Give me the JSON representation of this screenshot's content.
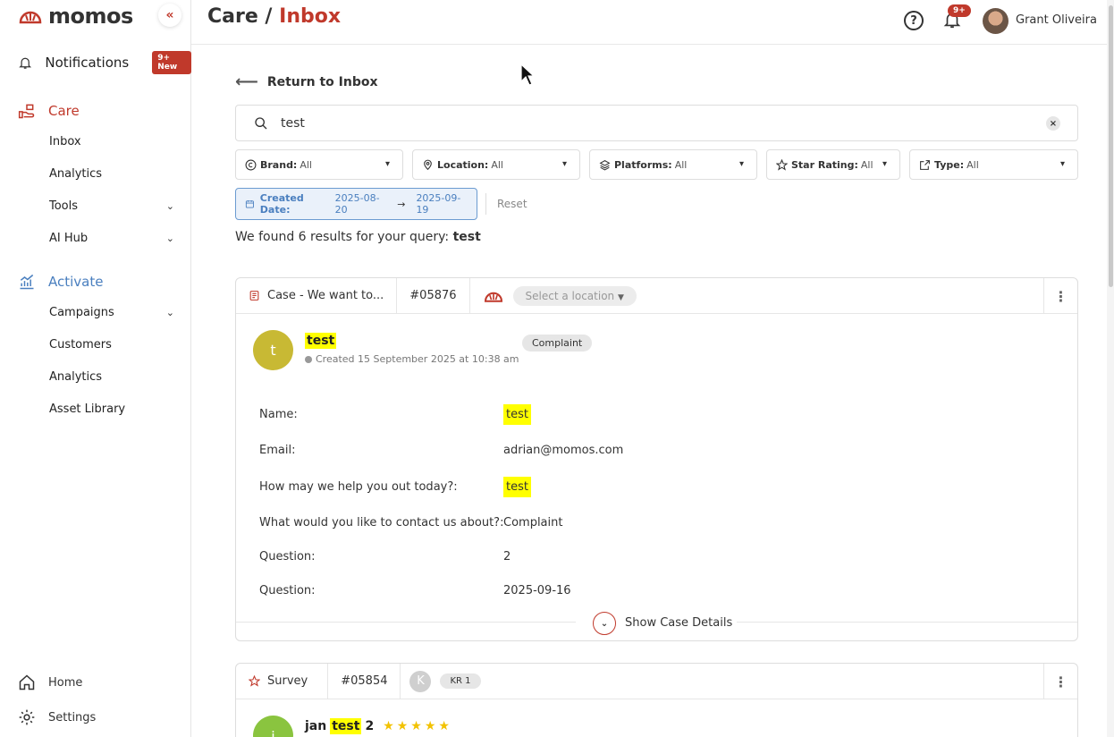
{
  "brand": {
    "name": "momos",
    "collapse": "«"
  },
  "sidebar": {
    "notifications": {
      "label": "Notifications",
      "badge": "9+ New"
    },
    "care": {
      "label": "Care",
      "items": [
        {
          "label": "Inbox"
        },
        {
          "label": "Analytics"
        },
        {
          "label": "Tools",
          "expandable": true
        },
        {
          "label": "AI Hub",
          "expandable": true
        }
      ]
    },
    "activate": {
      "label": "Activate",
      "items": [
        {
          "label": "Campaigns",
          "expandable": true
        },
        {
          "label": "Customers"
        },
        {
          "label": "Analytics"
        },
        {
          "label": "Asset Library"
        }
      ]
    },
    "home": "Home",
    "settings": "Settings"
  },
  "header": {
    "crumb_parent": "Care /",
    "crumb_current": "Inbox",
    "help": "?",
    "notif_count": "9+",
    "user_name": "Grant Oliveira"
  },
  "main": {
    "return_label": "Return to Inbox",
    "search": {
      "value": "test",
      "clear": "×"
    },
    "filters": [
      {
        "label": "Brand:",
        "value": "All",
        "icon": "copyright-icon"
      },
      {
        "label": "Location:",
        "value": "All",
        "icon": "location-pin-icon"
      },
      {
        "label": "Platforms:",
        "value": "All",
        "icon": "layers-icon"
      },
      {
        "label": "Star Rating:",
        "value": "All",
        "icon": "star-icon"
      },
      {
        "label": "Type:",
        "value": "All",
        "icon": "external-link-icon"
      }
    ],
    "date_filter": {
      "label": "Created Date:",
      "from": "2025-08-20",
      "arrow": "→",
      "to": "2025-09-19"
    },
    "reset": "Reset",
    "result_prefix": "We found 6 results for your query:",
    "result_query": "test"
  },
  "case_card": {
    "title": "Case - We want to...",
    "id": "#05876",
    "location_placeholder": "Select a location",
    "avatar_letter": "t",
    "name": "test",
    "created": "Created 15 September 2025 at 10:38 am",
    "tag": "Complaint",
    "fields": [
      {
        "label": "Name:",
        "value": "test",
        "highlight": true
      },
      {
        "label": "Email:",
        "value": "adrian@momos.com",
        "highlight": false
      },
      {
        "label": "How may we help you out today?:",
        "value": "test",
        "highlight": true
      },
      {
        "label": "What would you like to contact us about?:",
        "value": "Complaint",
        "highlight": false
      },
      {
        "label": "Question:",
        "value": "2",
        "highlight": false
      },
      {
        "label": "Question:",
        "value": "2025-09-16",
        "highlight": false
      }
    ],
    "show_details": "Show Case Details"
  },
  "survey_card": {
    "title": "Survey",
    "id": "#05854",
    "avatar_letter": "K",
    "location": "KR 1",
    "user_avatar": "j",
    "name_prefix": "jan",
    "name_highlight": "test",
    "name_suffix": "2",
    "rating": 5,
    "stars": "★★★★★"
  },
  "colors": {
    "accent": "#c0392b",
    "activate": "#4a7fbf",
    "highlight": "#ffff00"
  }
}
